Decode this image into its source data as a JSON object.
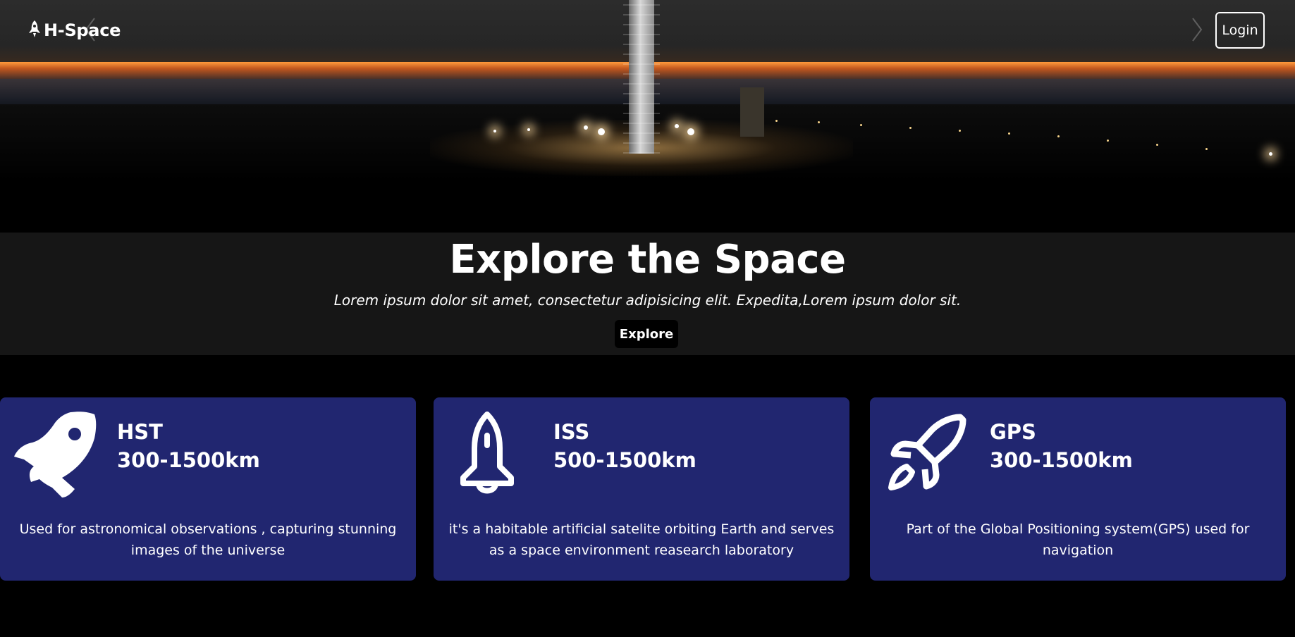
{
  "nav": {
    "brand": "H-Space",
    "login_label": "Login"
  },
  "hero": {
    "title": "Explore the Space",
    "subtitle": "Lorem ipsum dolor sit amet, consectetur adipisicing elit. Expedita,Lorem ipsum dolor sit.",
    "explore_label": "Explore"
  },
  "cards": [
    {
      "icon": "rocket-icon",
      "name": "HST",
      "range": "300-1500km",
      "description": "Used for astronomical observations , capturing stunning images of the universe"
    },
    {
      "icon": "space-shuttle-icon",
      "name": "ISS",
      "range": "500-1500km",
      "description": "it's a habitable artificial satelite orbiting Earth and serves as a space environment reasearch laboratory"
    },
    {
      "icon": "rocket-outline-icon",
      "name": "GPS",
      "range": "300-1500km",
      "description": "Part of the Global Positioning system(GPS) used for navigation"
    }
  ],
  "colors": {
    "card_background": "#212670",
    "hero_band": "#161616",
    "page_background": "#000000"
  }
}
